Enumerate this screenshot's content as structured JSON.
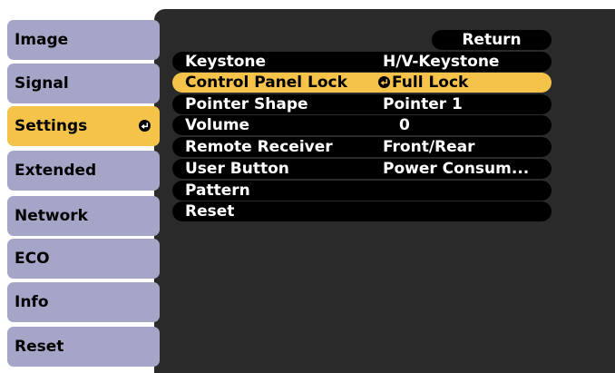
{
  "menu": {
    "items": [
      {
        "label": "Image"
      },
      {
        "label": "Signal"
      },
      {
        "label": "Settings"
      },
      {
        "label": "Extended"
      },
      {
        "label": "Network"
      },
      {
        "label": "ECO"
      },
      {
        "label": "Info"
      },
      {
        "label": "Reset"
      }
    ],
    "selected_index": 2
  },
  "submenu": {
    "return_label": "Return",
    "rows": [
      {
        "label": "Keystone",
        "value": "H/V-Keystone"
      },
      {
        "label": "Control Panel Lock",
        "value": "Full Lock"
      },
      {
        "label": "Pointer Shape",
        "value": "Pointer 1"
      },
      {
        "label": "Volume",
        "value": "0"
      },
      {
        "label": "Remote Receiver",
        "value": "Front/Rear"
      },
      {
        "label": "User Button",
        "value": "Power Consum..."
      },
      {
        "label": "Pattern",
        "value": ""
      },
      {
        "label": "Reset",
        "value": ""
      }
    ],
    "selected_index": 1
  },
  "colors": {
    "highlight": "#f5c24a",
    "menu_item": "#a5a5c7",
    "panel_bg": "#2a2a2a",
    "row_bg": "#000000"
  }
}
